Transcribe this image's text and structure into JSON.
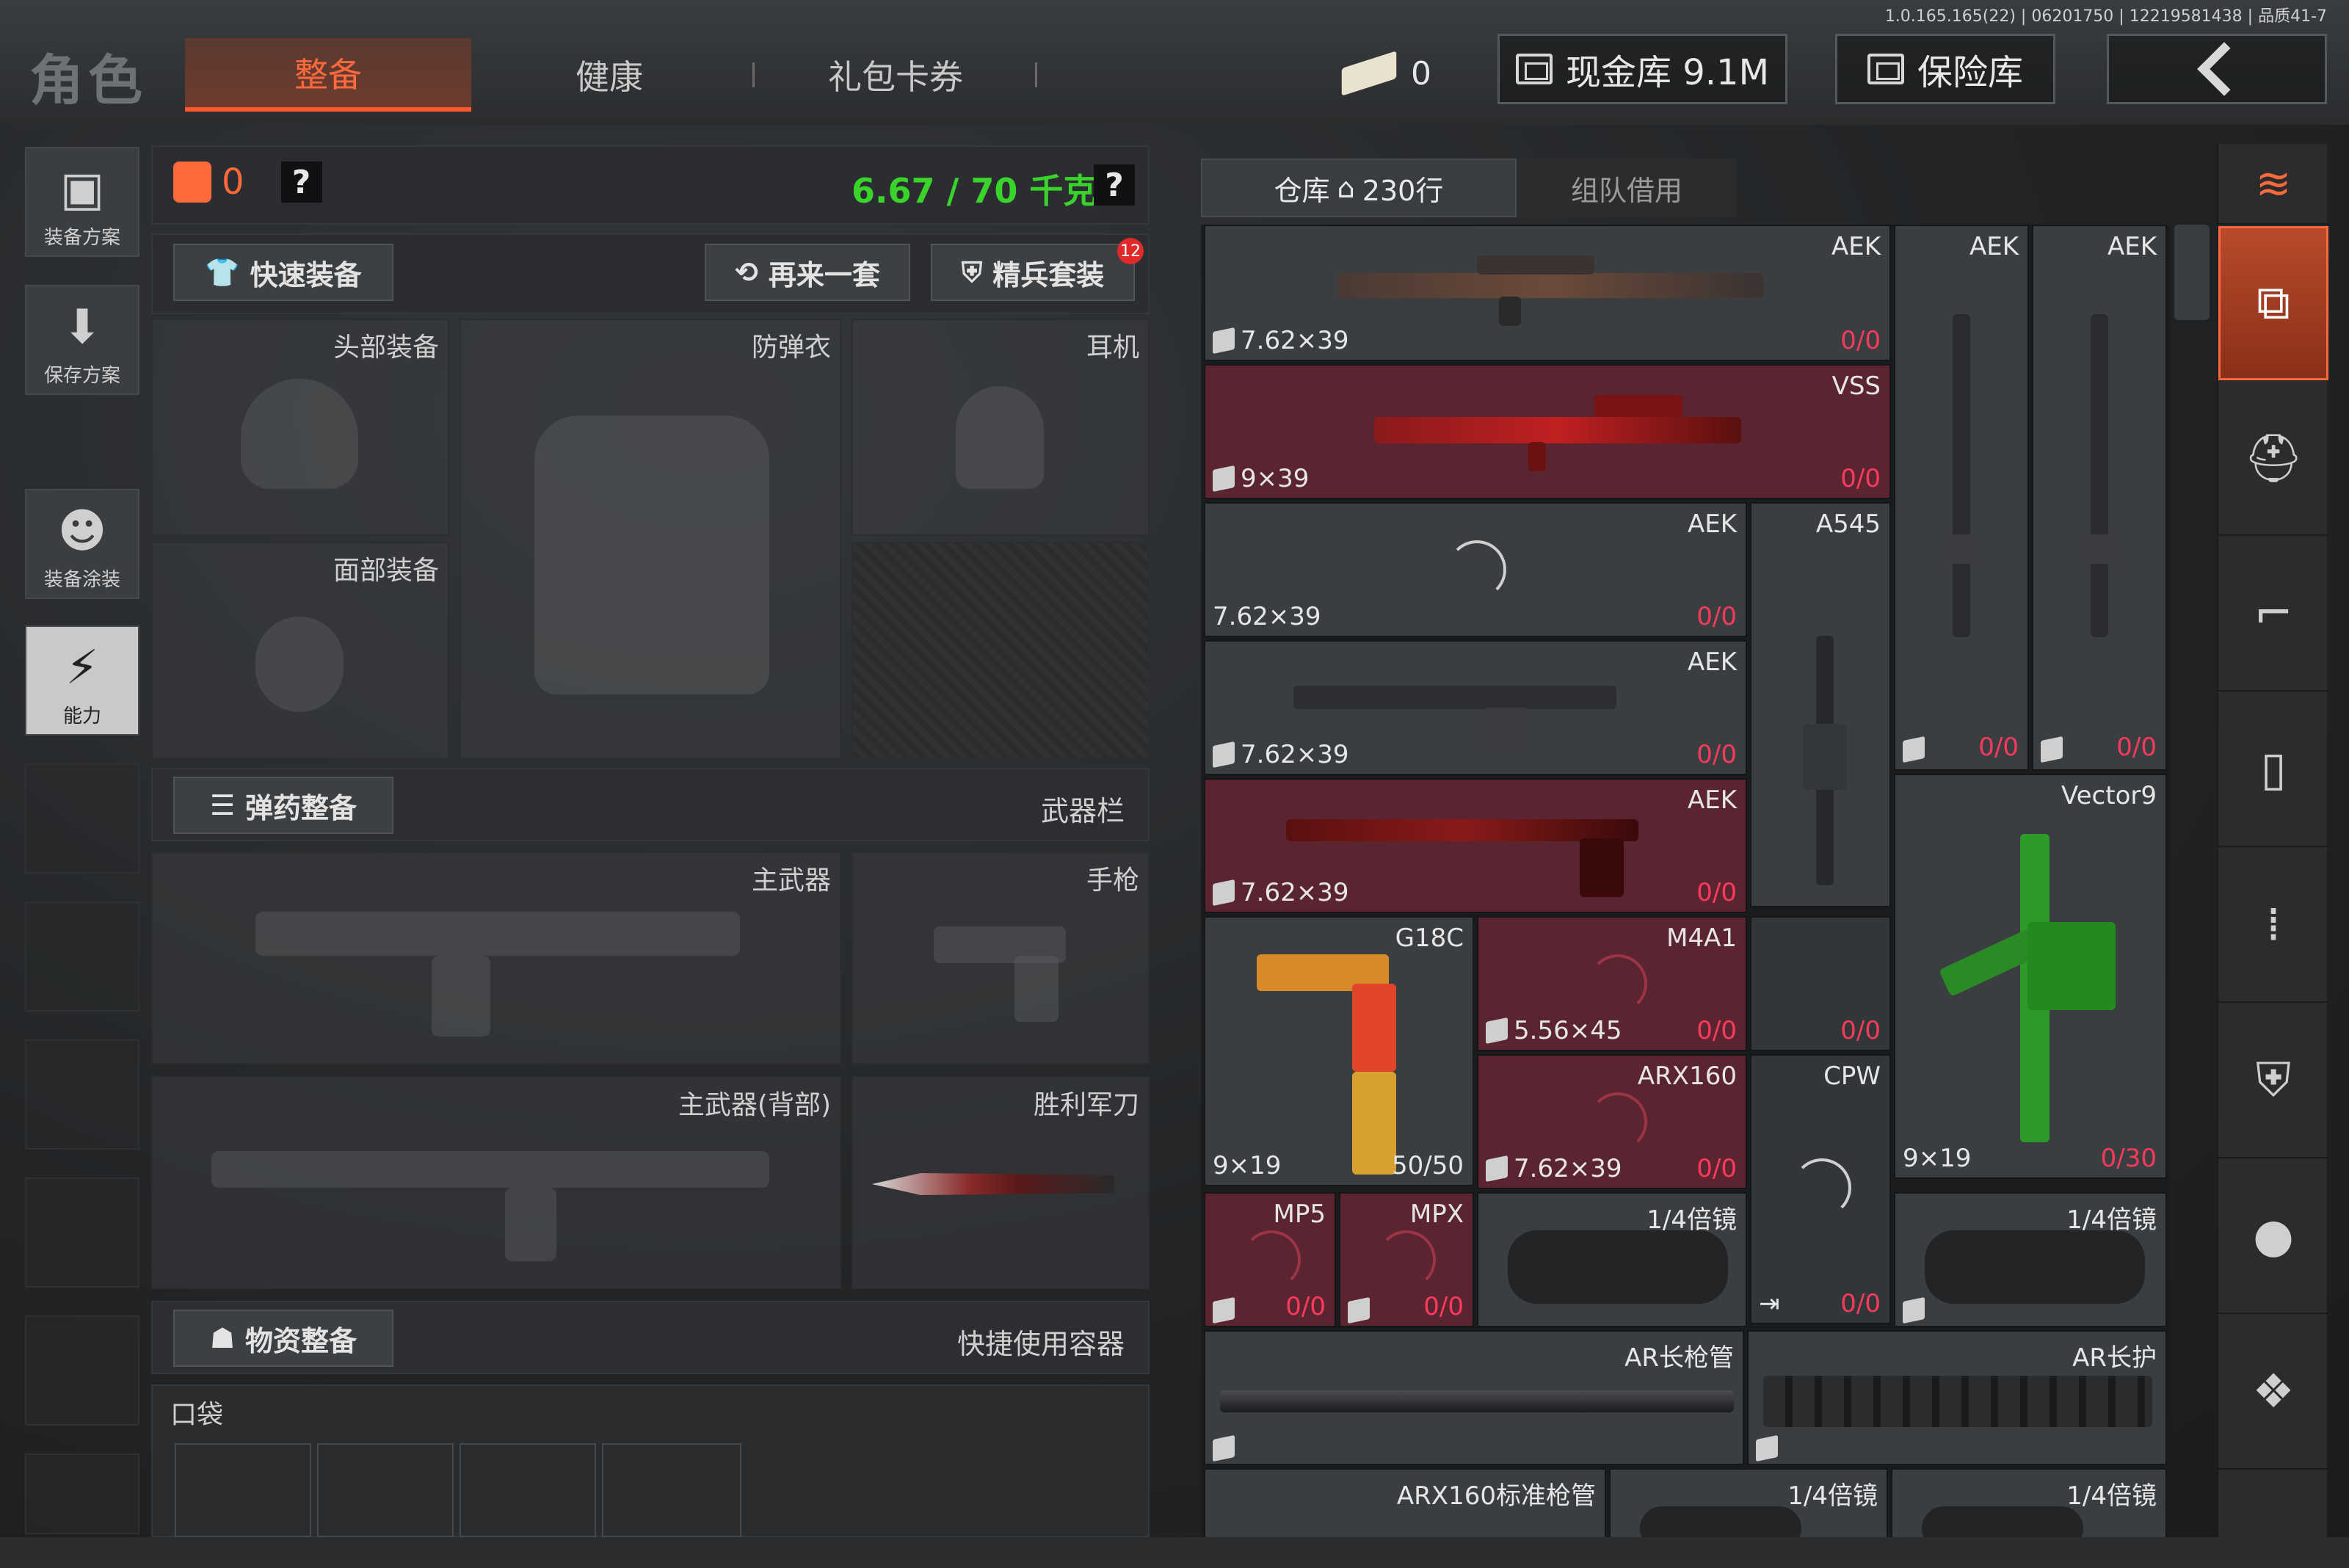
{
  "version_info": "1.0.165.165(22) | 06201750 | 12219581438 | 品质41-7",
  "header": {
    "title": "角色",
    "tabs": [
      "整备",
      "健康",
      "礼包卡券"
    ],
    "ticket_count": "0",
    "vault_label": "现金库 9.1M",
    "safe_label": "保险库"
  },
  "left_sidebar": {
    "items": [
      "装备方案",
      "保存方案",
      "装备涂装",
      "能力"
    ]
  },
  "loadout": {
    "backpack_count": "0",
    "weight": "6.67 / 70 千克",
    "quick_equip": "快速装备",
    "redo": "再来一套",
    "elite": "精兵套装",
    "elite_badge": "12",
    "slots": {
      "head": "头部装备",
      "armor": "防弹衣",
      "headset": "耳机",
      "face": "面部装备"
    },
    "ammo_button": "弹药整备",
    "weapon_bar": "武器栏",
    "weapon_slots": {
      "primary": "主武器",
      "pistol": "手枪",
      "primary_back": "主武器(背部)",
      "knife": "胜利军刀"
    },
    "supply_button": "物资整备",
    "quick_container": "快捷使用容器",
    "pocket": "口袋"
  },
  "inventory": {
    "tabs": [
      "仓库",
      "230行",
      "组队借用"
    ],
    "cells": [
      {
        "name": "AEK",
        "caliber": "7.62×39",
        "count": "0/0"
      },
      {
        "name": "AEK",
        "caliber": "",
        "count": ""
      },
      {
        "name": "AEK",
        "caliber": "",
        "count": ""
      },
      {
        "name": "VSS",
        "caliber": "9×39",
        "count": "0/0"
      },
      {
        "name": "AEK",
        "caliber": "7.62×39",
        "count": "0/0"
      },
      {
        "name": "A545",
        "caliber": "",
        "count": ""
      },
      {
        "name": "AEK",
        "caliber": "7.62×39",
        "count": "0/0"
      },
      {
        "name": "",
        "caliber": "",
        "count": "0/0"
      },
      {
        "name": "",
        "caliber": "",
        "count": "0/0"
      },
      {
        "name": "AEK",
        "caliber": "7.62×39",
        "count": "0/0"
      },
      {
        "name": "Vector9",
        "caliber": "9×19",
        "count": "0/30"
      },
      {
        "name": "G18C",
        "caliber": "9×19",
        "count": "50/50"
      },
      {
        "name": "M4A1",
        "caliber": "5.56×45",
        "count": "0/0"
      },
      {
        "name": "",
        "caliber": "",
        "count": "0/0"
      },
      {
        "name": "ARX160",
        "caliber": "7.62×39",
        "count": "0/0"
      },
      {
        "name": "CPW",
        "caliber": "",
        "count": "0/0"
      },
      {
        "name": "MP5",
        "caliber": "",
        "count": "0/0"
      },
      {
        "name": "MPX",
        "caliber": "",
        "count": "0/0"
      },
      {
        "name": "1/4倍镜",
        "caliber": "",
        "count": ""
      },
      {
        "name": "1/4倍镜",
        "caliber": "",
        "count": ""
      },
      {
        "name": "AR长枪管",
        "caliber": "",
        "count": ""
      },
      {
        "name": "AR长护",
        "caliber": "",
        "count": ""
      },
      {
        "name": "ARX160标准枪管",
        "caliber": "",
        "count": ""
      },
      {
        "name": "1/4倍镜",
        "caliber": "",
        "count": ""
      },
      {
        "name": "1/4倍镜",
        "caliber": "",
        "count": ""
      }
    ]
  },
  "right_sidebar": {
    "icons": [
      "stack-swap-icon",
      "all-items-icon",
      "helmet-icon",
      "rifle-icon",
      "magazine-icon",
      "ammo-icon",
      "armor-icon",
      "grenade-icon",
      "misc-icon"
    ]
  },
  "colors": {
    "accent": "#ff6a3d",
    "weight_green": "#3ad32c",
    "count_red": "#ff3a5c",
    "highlight_cell": "#5a2530"
  }
}
